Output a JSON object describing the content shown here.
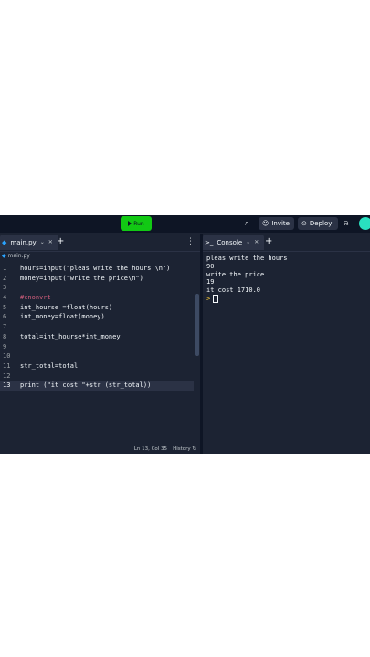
{
  "topbar": {
    "run_label": "Run",
    "invite_label": "Invite",
    "deploy_label": "Deploy"
  },
  "editor": {
    "tab_label": "main.py",
    "breadcrumb": "main.py",
    "lines": [
      {
        "n": "1",
        "text": "hours=input(\"pleas write the hours \\n\")"
      },
      {
        "n": "2",
        "text": "money=input(\"write the price\\n\")"
      },
      {
        "n": "3",
        "text": ""
      },
      {
        "n": "4",
        "text": "#cnonvrt"
      },
      {
        "n": "5",
        "text": "int_hourse =float(hours)"
      },
      {
        "n": "6",
        "text": "int_money=float(money)"
      },
      {
        "n": "7",
        "text": ""
      },
      {
        "n": "8",
        "text": "total=int_hourse*int_money"
      },
      {
        "n": "9",
        "text": ""
      },
      {
        "n": "10",
        "text": ""
      },
      {
        "n": "11",
        "text": "str_total=total"
      },
      {
        "n": "12",
        "text": ""
      },
      {
        "n": "13",
        "text": "print (\"it cost \"+str (str_total))"
      }
    ],
    "status_position": "Ln 13, Col 35",
    "status_history": "History"
  },
  "console": {
    "tab_label": "Console",
    "output": [
      "pleas write the hours",
      "90",
      "write the price",
      "19",
      "it cost 1710.0"
    ],
    "prompt": ">"
  },
  "colors": {
    "run_button": "#12c914",
    "background": "#1c2333",
    "keyword_yellow": "#ffcf32",
    "comment_pink": "#d15e7c"
  }
}
